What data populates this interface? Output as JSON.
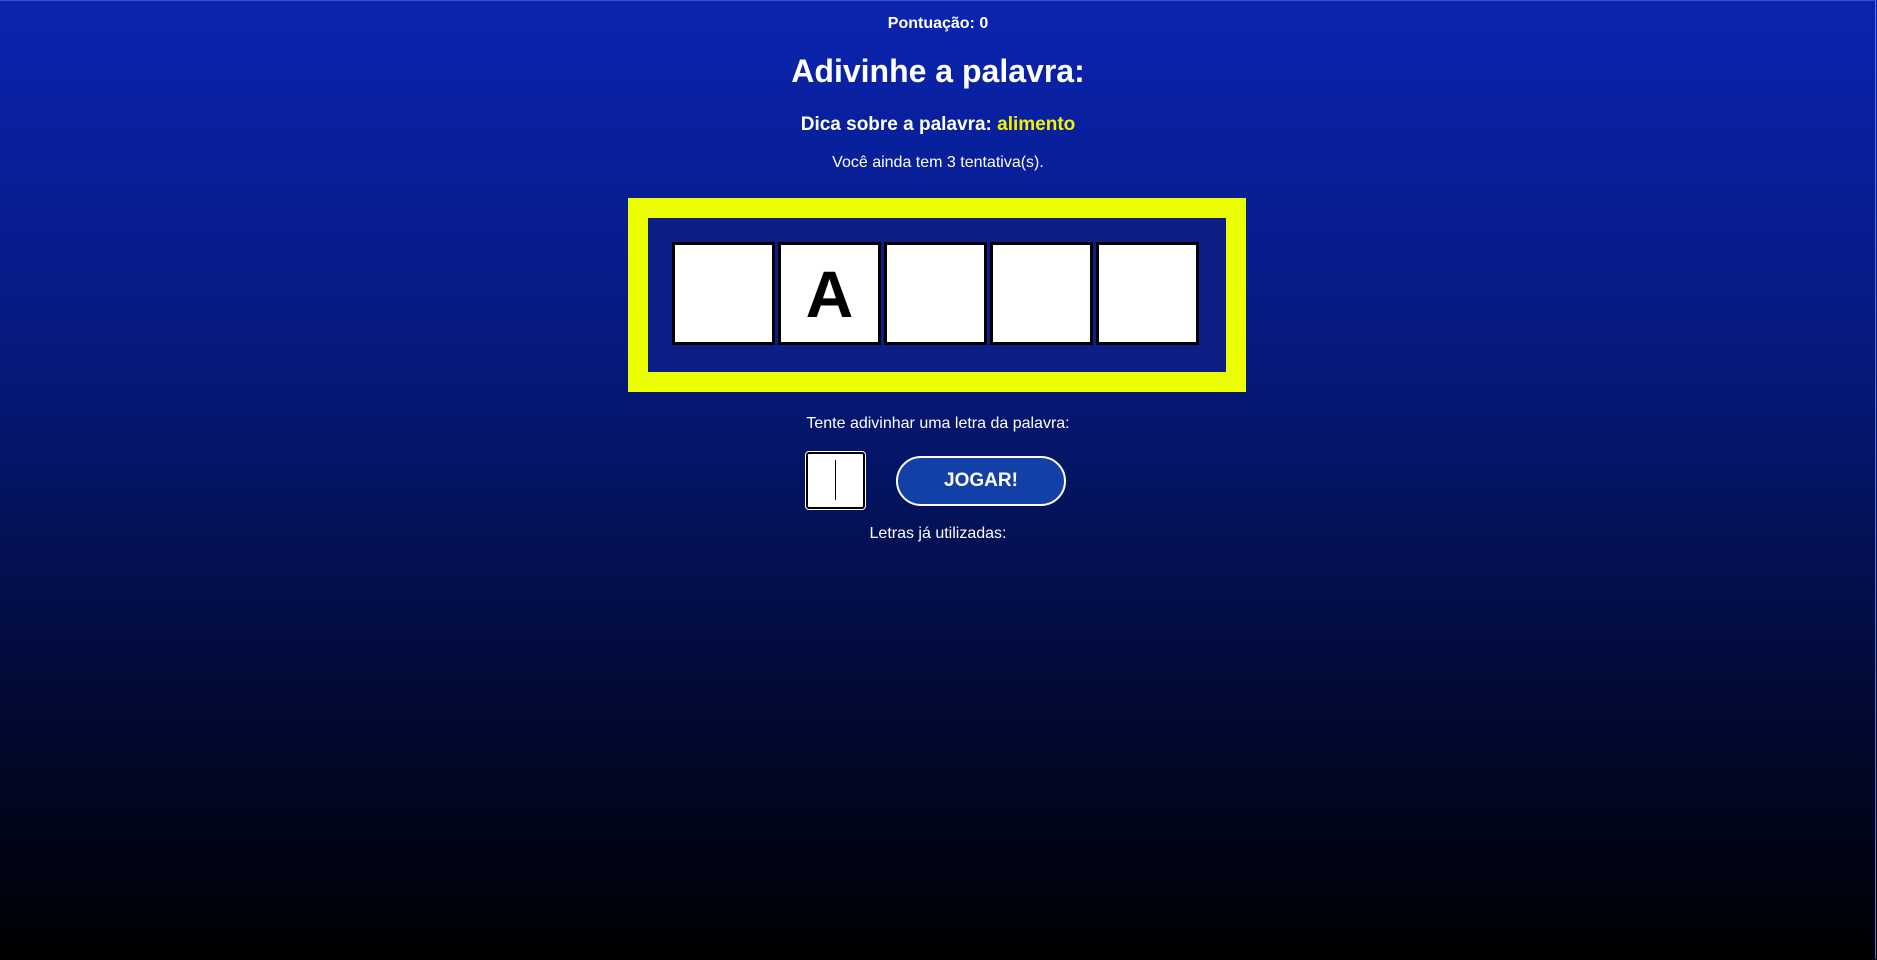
{
  "game": {
    "score_label": "Pontuação: 0",
    "title": "Adivinhe a palavra:",
    "hint_label": "Dica sobre a palavra:",
    "hint_value": "alimento",
    "attempts_text": "Você ainda tem 3 tentativa(s).",
    "slots": [
      "",
      "A",
      "",
      "",
      ""
    ],
    "prompt": "Tente adivinhar uma letra da palavra:",
    "input_value": "",
    "play_button": "JOGAR!",
    "used_letters_label": "Letras já utilizadas:"
  },
  "colors": {
    "accent_yellow": "#ecff00",
    "hint_yellow": "#f3f300",
    "button_blue": "#1240a6",
    "board_blue": "#0c1f86"
  }
}
